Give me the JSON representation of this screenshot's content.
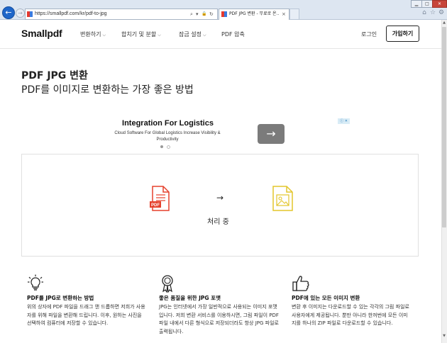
{
  "browser": {
    "url": "https://smallpdf.com/kr/pdf-to-jpg",
    "tab_title": "PDF JPG 변환 - 무료로 온...",
    "back_icon": "←",
    "forward_icon": "→",
    "search_icon": "⌕",
    "dropdown_icon": "▾",
    "lock_icon": "🔒",
    "refresh_icon": "↻",
    "close_tab_icon": "×",
    "home_icon": "⌂",
    "star_icon": "☆",
    "settings_icon": "⚙",
    "minimize_icon": "▁",
    "maximize_icon": "□",
    "close_icon": "✕"
  },
  "header": {
    "logo": "Smallpdf",
    "menu": [
      {
        "label": "변환하기"
      },
      {
        "label": "합치기 및 분할"
      },
      {
        "label": "잠금 설정"
      },
      {
        "label": "PDF 압축"
      }
    ],
    "chevron": "⌵",
    "login": "로그인",
    "signup": "가입하기"
  },
  "hero": {
    "title": "PDF JPG 변환",
    "subtitle": "PDF를 이미지로 변환하는 가장 좋은 방법"
  },
  "ad": {
    "title": "Integration For Logistics",
    "subtitle": "Cloud Software For Global Logistics Increase Visibility & Productivity",
    "arrow": "→",
    "badge": "ⓘ ✕"
  },
  "converter": {
    "arrow": "→",
    "status": "처리 중",
    "pdf_label": "PDF",
    "accent_pdf": "#e5412d",
    "accent_jpg": "#e3c62b"
  },
  "features": [
    {
      "icon": "lightbulb-icon",
      "title": "PDF를 JPG로 변환하는 방법",
      "body": "위의 상자에 PDF 파일을 드래그 앤 드롭하면 저희가 사용자를 위해 파일을 변환해 드립니다. 이후, 원하는 사진을 선택하여 컴퓨터에 저장할 수 있습니다."
    },
    {
      "icon": "award-ribbon-icon",
      "title": "좋은 품질을 위한 JPG 포맷",
      "body": "JPG는 인터넷에서 가장 일반적으로 사용되는 이미지 포맷입니다. 저희 변환 서비스를 이용하시면, 그림 파일이 PDF 파일 내에서 다른 형식으로 저장되더라도 항상 JPG 파일로 출력됩니다."
    },
    {
      "icon": "thumbs-up-icon",
      "title": "PDF에 있는 모든 이미지 변환",
      "body": "변환 후 이미지는 다운로드할 수 있는 각각의 그림 파일로 사용자에게 제공됩니다. 뿐만 아니라 한꺼번에 모든 이미지를 하나의 ZIP 파일로 다운로드할 수 있습니다."
    }
  ]
}
